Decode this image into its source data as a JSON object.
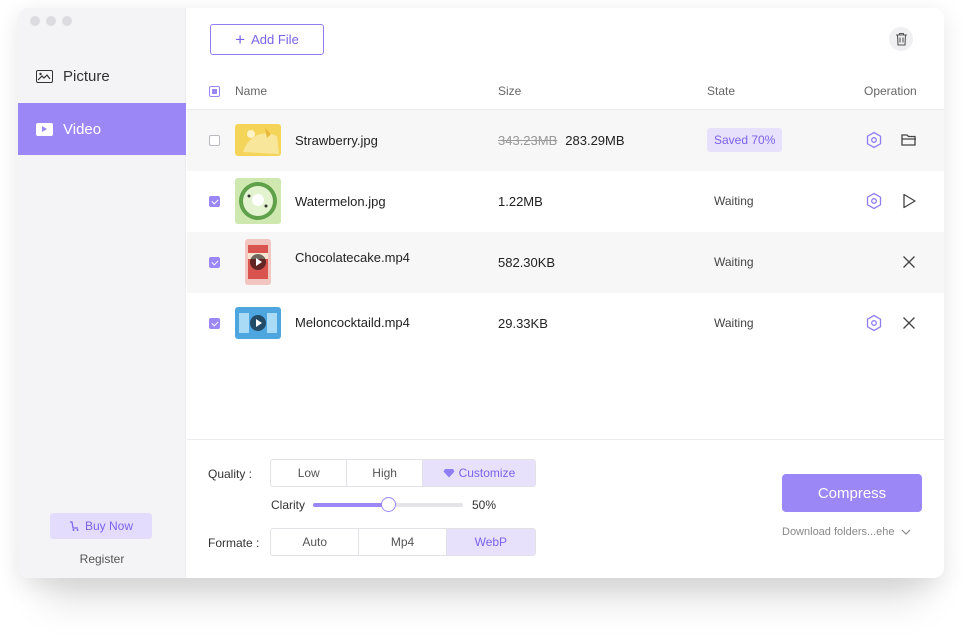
{
  "sidebar": {
    "items": [
      {
        "label": "Picture",
        "icon": "picture-icon",
        "active": false
      },
      {
        "label": "Video",
        "icon": "video-icon",
        "active": true
      }
    ],
    "buy_label": "Buy Now",
    "register_label": "Register"
  },
  "toolbar": {
    "add_label": "Add File"
  },
  "table": {
    "headers": {
      "name": "Name",
      "size": "Size",
      "state": "State",
      "operation": "Operation"
    },
    "rows": [
      {
        "name": "Strawberry.jpg",
        "old_size": "343.23MB",
        "size": "283.29MB",
        "state": "Saved 70%",
        "checked": false
      },
      {
        "name": "Watermelon.jpg",
        "old_size": "",
        "size": "1.22MB",
        "state": "Waiting",
        "checked": true
      },
      {
        "name": "Chocolatecake.mp4",
        "old_size": "",
        "size": "582.30KB",
        "state": "Waiting",
        "checked": true
      },
      {
        "name": "Meloncocktaild.mp4",
        "old_size": "",
        "size": "29.33KB",
        "state": "Waiting",
        "checked": true
      }
    ]
  },
  "settings": {
    "quality_label": "Quality :",
    "quality_options": [
      "Low",
      "High",
      "Customize"
    ],
    "quality_selected": "Customize",
    "clarity_label": "Clarity",
    "clarity_value": "50%",
    "clarity_fraction": 0.5,
    "format_label": "Formate :",
    "format_options": [
      "Auto",
      "Mp4",
      "WebP"
    ],
    "format_selected": "WebP"
  },
  "compress_label": "Compress",
  "download_label": "Download folders...ehe",
  "colors": {
    "accent": "#9b87f5",
    "accent_light": "#e7e1fc"
  }
}
